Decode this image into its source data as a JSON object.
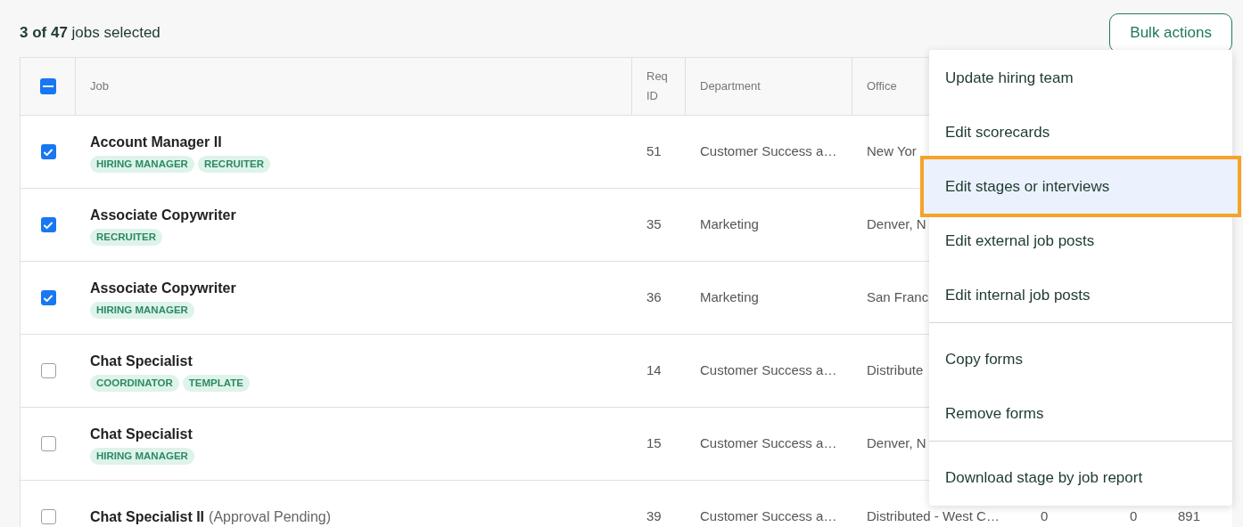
{
  "selection_summary": "**3 of 47** jobs selected",
  "bulk_actions_button": "Bulk actions",
  "table": {
    "header_checkbox": {
      "indeterminate": true
    },
    "columns": [
      "Job",
      "Req ID",
      "Department",
      "Office"
    ],
    "rows": [
      {
        "checked": true,
        "job": "Account Manager II",
        "tags": [
          "HIRING MANAGER",
          "RECRUITER"
        ],
        "req_id": "51",
        "department": "Customer Success a…",
        "office": "New Yor"
      },
      {
        "checked": true,
        "job": "Associate Copywriter",
        "tags": [
          "RECRUITER"
        ],
        "req_id": "35",
        "department": "Marketing",
        "office": "Denver, N"
      },
      {
        "checked": true,
        "job": "Associate Copywriter",
        "tags": [
          "HIRING MANAGER"
        ],
        "req_id": "36",
        "department": "Marketing",
        "office": "San Franc"
      },
      {
        "checked": false,
        "job": "Chat Specialist",
        "tags": [
          "COORDINATOR",
          "TEMPLATE"
        ],
        "req_id": "14",
        "department": "Customer Success a…",
        "office": "Distribute"
      },
      {
        "checked": false,
        "job": "Chat Specialist",
        "tags": [
          "HIRING MANAGER"
        ],
        "req_id": "15",
        "department": "Customer Success a…",
        "office": "Denver, N"
      },
      {
        "checked": false,
        "job": "Chat Specialist II",
        "note": "(Approval Pending)",
        "tags": [],
        "req_id": "39",
        "department": "Customer Success a…",
        "office": "Distributed - West C…",
        "column_5": "0",
        "column_6": "0",
        "column_7": "891"
      }
    ]
  },
  "menu": {
    "groups": [
      [
        {
          "label": "Update hiring team",
          "selected": false
        },
        {
          "label": "Edit scorecards",
          "selected": false
        },
        {
          "label": "Edit stages or interviews",
          "selected": true
        },
        {
          "label": "Edit external job posts",
          "selected": false
        },
        {
          "label": "Edit internal job posts",
          "selected": false
        }
      ],
      [
        {
          "label": "Copy forms",
          "selected": false
        },
        {
          "label": "Remove forms",
          "selected": false
        }
      ],
      [
        {
          "label": "Download stage by job report",
          "selected": false
        }
      ]
    ]
  }
}
